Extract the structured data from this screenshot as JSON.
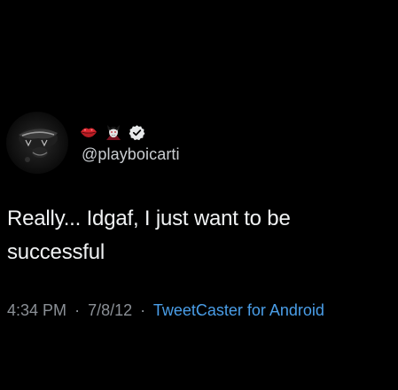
{
  "tweet": {
    "handle": "@playboicarti",
    "text_line_1": "Really... Idgaf, I just want to be",
    "text_line_2": "successful",
    "time": "4:34 PM",
    "separator": "·",
    "date": "7/8/12",
    "source": "TweetCaster for Android",
    "name_icons": [
      "lips-kiss-icon",
      "vampire-icon",
      "verified-badge-icon"
    ]
  },
  "colors": {
    "background": "#000000",
    "text": "#f0f2f3",
    "secondary_text": "#8b9096",
    "link": "#4a9ee8",
    "lips": "#d7262e",
    "verified_badge": "#e7e9ea"
  }
}
